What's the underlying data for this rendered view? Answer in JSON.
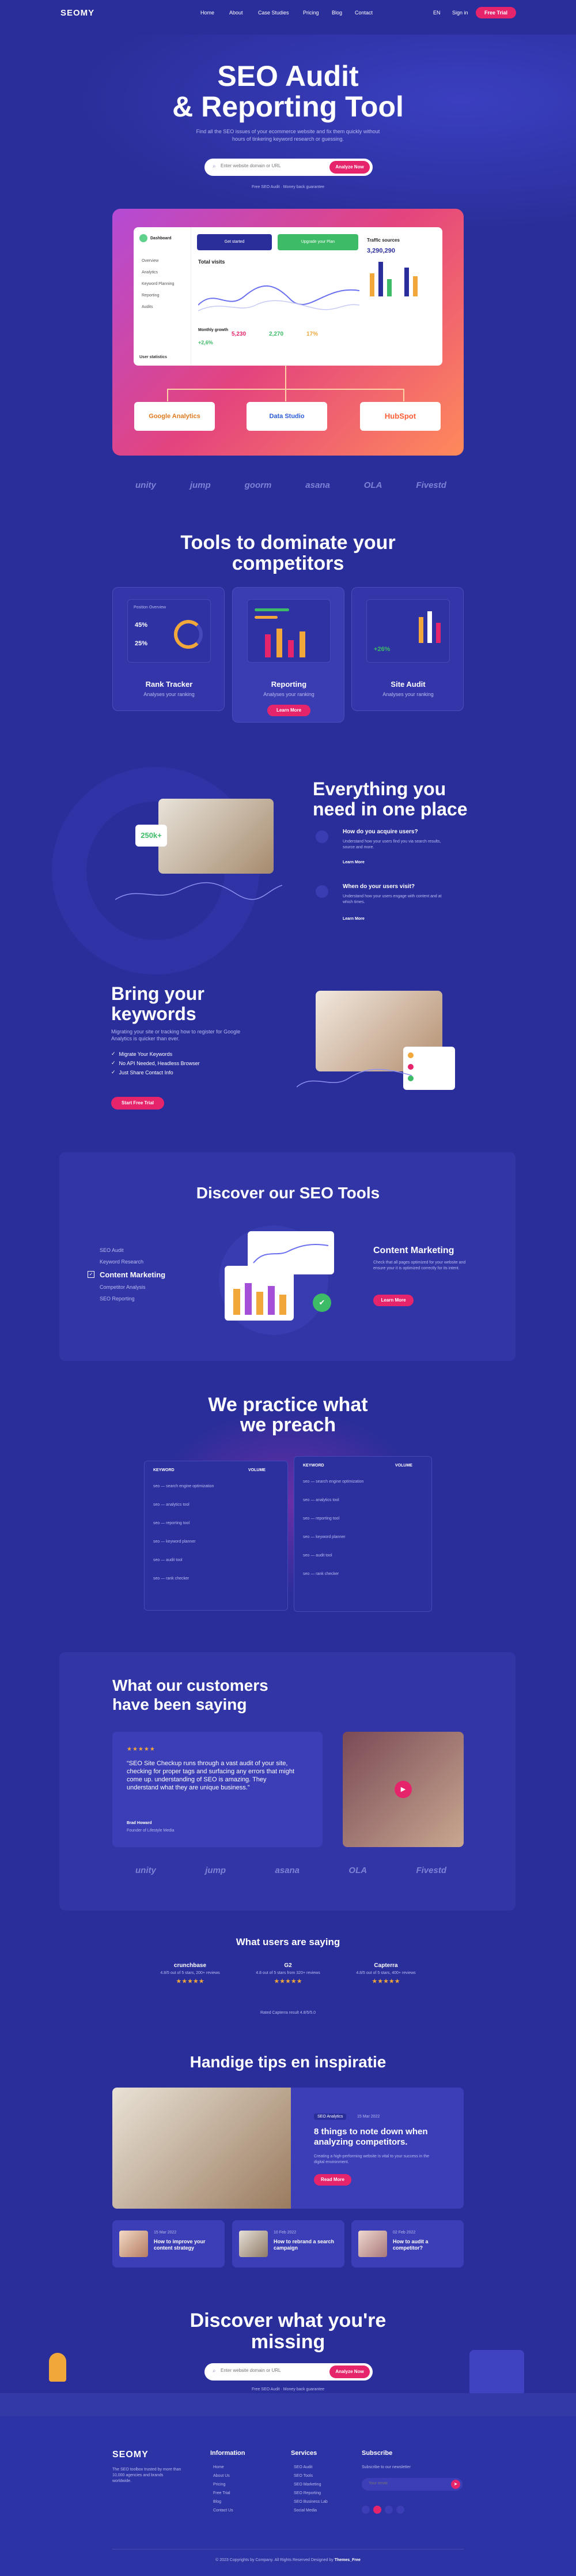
{
  "colors": {
    "bg": "#2a2e9a",
    "accent": "#e6246b",
    "card": "#3335a8",
    "text_muted": "#b9bbf0"
  },
  "nav": {
    "logo": "SEOMY",
    "links": [
      "Home",
      "About",
      "Case Studies",
      "Pricing",
      "Blog",
      "Contact"
    ],
    "lang": "EN",
    "signin": "Sign in",
    "cta": "Free Trial"
  },
  "hero": {
    "title1": "SEO Audit",
    "title2": "& Reporting Tool",
    "desc": "Find all the SEO issues of your ecommerce website and fix them quickly without hours of tinkering keyword research or guessing.",
    "placeholder": "Enter website domain or URL",
    "button": "Analyze Now",
    "note": "Free SEO Audit  ·  Money back guarantee"
  },
  "dashboard": {
    "user": "Dashboard",
    "get_started": "Get started",
    "upgrade": "Upgrade your Plan",
    "traffic_title": "Total visits",
    "traffic_source": "Traffic sources",
    "traffic_value": "3,290,290",
    "growth_label": "Monthly growth",
    "growth_value": "+2,6%",
    "stat1": "5,230",
    "stat2": "2,270",
    "stat3": "17%",
    "integrations": [
      "Google Analytics",
      "Data Studio",
      "HubSpot"
    ],
    "sidebar": [
      "Overview",
      "Analytics",
      "Keyword Planning",
      "Reporting",
      "Audits"
    ],
    "footer_label": "User statistics"
  },
  "partners": [
    "unity",
    "jump",
    "goorm",
    "asana",
    "OLA",
    "Fivestd"
  ],
  "tools": {
    "title1": "Tools to dominate your",
    "title2": "competitors",
    "cards": [
      {
        "title": "Rank Tracker",
        "desc": "Analyses your ranking",
        "mini_title": "Position Overview",
        "v1": "45%",
        "v2": "25%"
      },
      {
        "title": "Reporting",
        "desc": "Analyses your ranking",
        "button": "Learn More"
      },
      {
        "title": "Site Audit",
        "desc": "Analyses your ranking",
        "v1": "+26%"
      }
    ]
  },
  "everything": {
    "title1": "Everything you",
    "title2": "need in one place",
    "badge": "250k+",
    "items": [
      {
        "title": "How do you acquire users?",
        "desc": "Understand how your users find you via search results, source and more.",
        "link": "Learn More"
      },
      {
        "title": "When do your users visit?",
        "desc": "Understand how your users engage with content and at which times.",
        "link": "Learn More"
      }
    ]
  },
  "keywords": {
    "title1": "Bring your",
    "title2": "keywords",
    "desc": "Migrating your site or tracking how to register for Google Analytics is quicker than ever.",
    "bullets": [
      "Migrate Your Keywords",
      "No API Needed, Headless Browser",
      "Just Share Contact Info"
    ],
    "button": "Start Free Trial"
  },
  "discover_tools": {
    "title": "Discover our SEO Tools",
    "list": [
      "SEO Audit",
      "Keyword Research",
      "Content Marketing",
      "Competitor Analysis",
      "SEO Reporting"
    ],
    "active_title": "Content Marketing",
    "active_desc": "Check that all pages optimized for your website and ensure your it is optimized correctly for its intent.",
    "button": "Learn More"
  },
  "preach": {
    "title1": "We practice what",
    "title2": "we preach",
    "col1_head": "KEYWORD",
    "col2_head": "VOLUME",
    "rows": [
      "seo — search engine optimization",
      "seo — analytics tool",
      "seo — reporting tool",
      "seo — keyword planner",
      "seo — audit tool",
      "seo — rank checker"
    ]
  },
  "testimonials": {
    "title1": "What our customers",
    "title2": "have been saying",
    "stars": "★★★★★",
    "quote": "“SEO Site Checkup runs through a vast audit of your site, checking for proper tags and surfacing any errors that might come up. understanding of SEO is amazing. They understand what they are unique business.”",
    "author": "Brad Howard",
    "role": "Founder of Lifestyle Media"
  },
  "users": {
    "title": "What users are saying",
    "brands": [
      {
        "name": "crunchbase",
        "desc": "4.8/5 out of 5 stars, 200+ reviews"
      },
      {
        "name": "G2",
        "desc": "4.8 out of 5 stars from 320+ reviews"
      },
      {
        "name": "Capterra",
        "desc": "4.8/5 out of 5 stars, 400+ reviews"
      }
    ],
    "stars": "★★★★★",
    "note": "Rated Capterra result 4.8/5/5.0"
  },
  "blog": {
    "title": "Handige tips en inspiratie",
    "main": {
      "tag": "SEO Analytics",
      "date": "15 Mar 2022",
      "title": "8 things to note down when analyzing competitors.",
      "desc": "Creating a high-performing website is vital to your success in the digital environment.",
      "button": "Read More"
    },
    "posts": [
      {
        "date": "15 Mar 2022",
        "title": "How to improve your content strategy"
      },
      {
        "date": "10 Feb 2022",
        "title": "How to rebrand a search campaign"
      },
      {
        "date": "02 Feb 2022",
        "title": "How to audit a competitor?"
      }
    ]
  },
  "discover": {
    "title1": "Discover what you're",
    "title2": "missing",
    "placeholder": "Enter website domain or URL",
    "button": "Analyze Now",
    "note": "Free SEO Audit  ·  Money back guarantee"
  },
  "footer": {
    "logo": "SEOMY",
    "about": "The SEO toolbox trusted by more than 10,000 agencies and brands worldwide.",
    "col1": {
      "title": "Information",
      "links": [
        "Home",
        "About Us",
        "Pricing",
        "Free Trial",
        "Blog",
        "Contact Us"
      ]
    },
    "col2": {
      "title": "Services",
      "links": [
        "SEO Audit",
        "SEO Tools",
        "SEO Marketing",
        "SEO Reporting",
        "SEO Business Lab",
        "Social Media"
      ]
    },
    "col3": {
      "title": "Subscribe",
      "desc": "Subscribe to our newsletter",
      "placeholder": "Your email"
    },
    "copyright": "© 2023 Copyrights by Company. All Rights Reserved Designed by ",
    "designer": "Themes_Free"
  }
}
